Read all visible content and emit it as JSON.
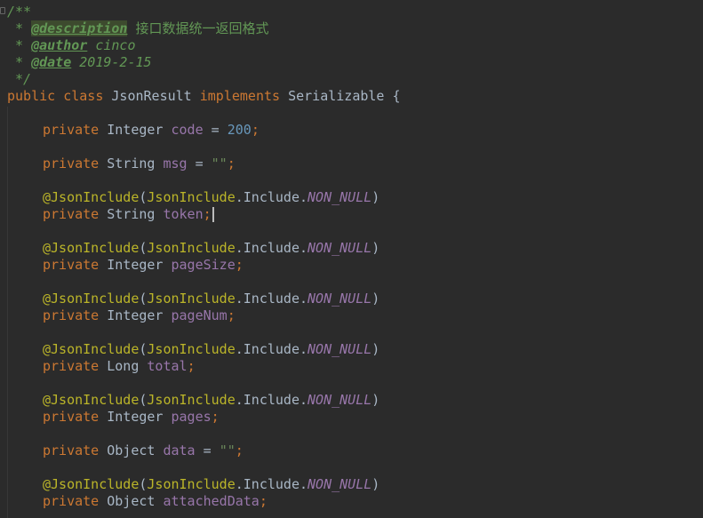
{
  "javadoc": {
    "open": "/**",
    "star": " * ",
    "close": " */",
    "description_tag": "@description",
    "description_text": "接口数据统一返回格式",
    "author_tag": "@author",
    "author_text": "cinco",
    "date_tag": "@date",
    "date_text": "2019-2-15"
  },
  "class_decl": {
    "kw_public": "public",
    "kw_class": "class",
    "name": "JsonResult",
    "kw_implements": "implements",
    "interface": "Serializable",
    "brace": "{"
  },
  "annotation": {
    "name": "@JsonInclude",
    "open_paren": "(",
    "type": "JsonInclude",
    "mid": ".Include.",
    "value": "NON_NULL",
    "close_paren": ")"
  },
  "kw_private": "private",
  "fields": [
    {
      "type": "Integer",
      "name": "code",
      "eq": " = ",
      "value": "200",
      "semi": ";"
    },
    {
      "type": "String",
      "name": "msg",
      "eq": " = ",
      "value": "\"\"",
      "semi": ";"
    },
    {
      "type": "String",
      "name": "token",
      "semi": ";"
    },
    {
      "type": "Integer",
      "name": "pageSize",
      "semi": ";"
    },
    {
      "type": "Integer",
      "name": "pageNum",
      "semi": ";"
    },
    {
      "type": "Long",
      "name": "total",
      "semi": ";"
    },
    {
      "type": "Integer",
      "name": "pages",
      "semi": ";"
    },
    {
      "type": "Object",
      "name": "data",
      "eq": " = ",
      "value": "\"\"",
      "semi": ";"
    },
    {
      "type": "Object",
      "name": "attachedData",
      "semi": ";"
    }
  ],
  "colors": {
    "background": "#2b2b2b",
    "keyword": "#cc7832",
    "default": "#a9b7c6",
    "number": "#6897bb",
    "string": "#6a8759",
    "field": "#9876aa",
    "annotation": "#bbb529",
    "doc_comment": "#629755"
  }
}
